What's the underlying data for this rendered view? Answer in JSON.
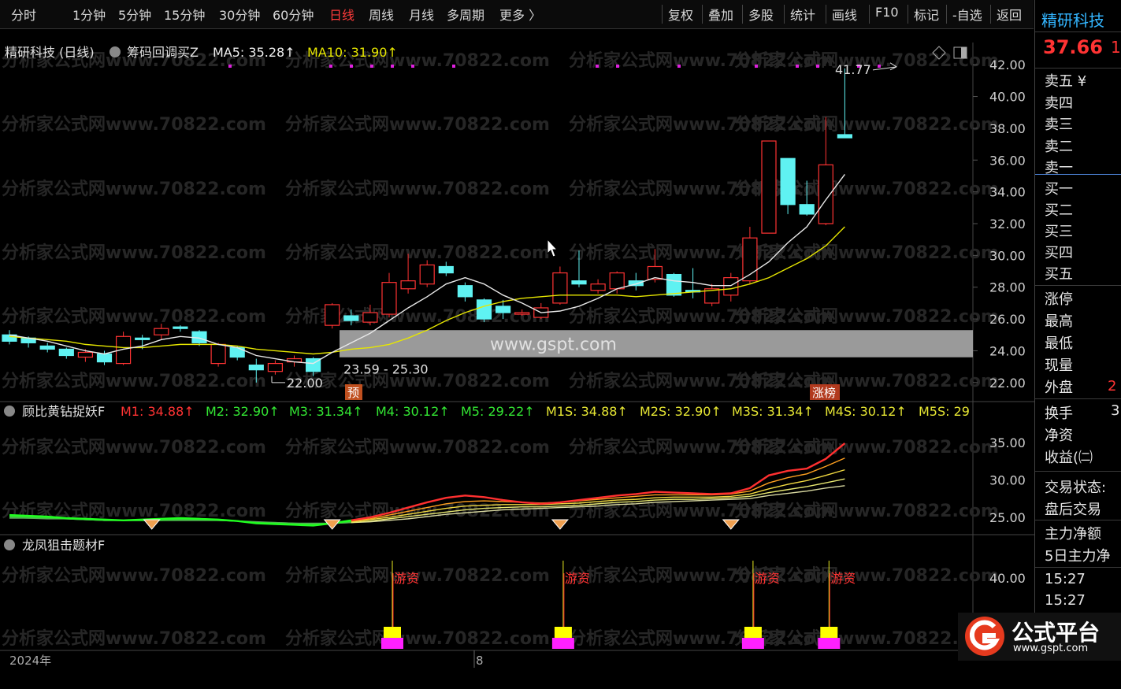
{
  "toolbar": {
    "periods": [
      "分时",
      "1分钟",
      "5分钟",
      "15分钟",
      "30分钟",
      "60分钟",
      "日线",
      "周线",
      "月线",
      "多周期",
      "更多 〉"
    ],
    "active_period": "日线",
    "buttons": [
      "复权",
      "叠加",
      "多股",
      "统计",
      "画线",
      "F10",
      "标记",
      "-自选",
      "返回"
    ]
  },
  "main_chart": {
    "title": "精研科技 (日线)",
    "indicator_name": "筹码回调买Z",
    "ma5_label": "MA5: 35.28↑",
    "ma10_label": "MA10: 31.90↑",
    "high_annotation": "41.77",
    "low_annotation": "22.00",
    "range_annotation": "23.59 - 25.30",
    "signal_yu": "预",
    "signal_zhangbang": "涨榜",
    "watermark_url": "www.gspt.com",
    "watermark_text": "分析家公式网www.70822.com",
    "colors": {
      "up": "#ff3333",
      "down": "#5ff2f2",
      "ma5": "#e8e8e8",
      "ma10": "#e6e600"
    }
  },
  "chart_data": [
    {
      "type": "candlestick",
      "ylim": [
        21,
        43
      ],
      "y_ticks": [
        "42.00",
        "40.00",
        "38.00",
        "36.00",
        "34.00",
        "32.00",
        "30.00",
        "28.00",
        "26.00",
        "24.00",
        "22.00"
      ],
      "candles": [
        {
          "o": 25.0,
          "c": 24.6,
          "h": 25.3,
          "l": 24.4
        },
        {
          "o": 24.8,
          "c": 24.5,
          "h": 24.9,
          "l": 24.2
        },
        {
          "o": 24.3,
          "c": 24.1,
          "h": 24.5,
          "l": 23.9
        },
        {
          "o": 24.1,
          "c": 23.7,
          "h": 24.2,
          "l": 23.5
        },
        {
          "o": 23.6,
          "c": 23.9,
          "h": 24.1,
          "l": 23.3
        },
        {
          "o": 23.8,
          "c": 23.3,
          "h": 24.0,
          "l": 23.1
        },
        {
          "o": 23.2,
          "c": 24.9,
          "h": 25.2,
          "l": 23.1
        },
        {
          "o": 24.8,
          "c": 24.7,
          "h": 25.0,
          "l": 24.1
        },
        {
          "o": 25.0,
          "c": 25.4,
          "h": 25.7,
          "l": 24.7
        },
        {
          "o": 25.5,
          "c": 25.4,
          "h": 25.6,
          "l": 25.2
        },
        {
          "o": 25.2,
          "c": 24.5,
          "h": 25.3,
          "l": 24.3
        },
        {
          "o": 23.2,
          "c": 24.4,
          "h": 24.5,
          "l": 23.0
        },
        {
          "o": 24.2,
          "c": 23.6,
          "h": 24.3,
          "l": 23.4
        },
        {
          "o": 23.1,
          "c": 22.8,
          "h": 23.5,
          "l": 22.0
        },
        {
          "o": 22.7,
          "c": 23.2,
          "h": 23.4,
          "l": 22.5
        },
        {
          "o": 23.3,
          "c": 23.5,
          "h": 23.7,
          "l": 23.0
        },
        {
          "o": 23.5,
          "c": 22.7,
          "h": 23.6,
          "l": 22.4
        },
        {
          "o": 25.6,
          "c": 26.9,
          "h": 27.0,
          "l": 25.4
        },
        {
          "o": 26.2,
          "c": 25.9,
          "h": 26.6,
          "l": 25.6
        },
        {
          "o": 25.8,
          "c": 26.4,
          "h": 26.9,
          "l": 25.6
        },
        {
          "o": 26.3,
          "c": 28.3,
          "h": 28.9,
          "l": 26.1
        },
        {
          "o": 27.9,
          "c": 28.4,
          "h": 30.1,
          "l": 27.6
        },
        {
          "o": 28.2,
          "c": 29.4,
          "h": 29.7,
          "l": 28.0
        },
        {
          "o": 29.3,
          "c": 28.9,
          "h": 29.6,
          "l": 28.7
        },
        {
          "o": 28.1,
          "c": 27.4,
          "h": 28.3,
          "l": 27.1
        },
        {
          "o": 27.2,
          "c": 26.0,
          "h": 27.3,
          "l": 25.8
        },
        {
          "o": 26.8,
          "c": 26.4,
          "h": 27.2,
          "l": 26.0
        },
        {
          "o": 26.3,
          "c": 26.4,
          "h": 26.6,
          "l": 26.2
        },
        {
          "o": 26.1,
          "c": 26.7,
          "h": 27.0,
          "l": 26.0
        },
        {
          "o": 27.0,
          "c": 28.9,
          "h": 29.3,
          "l": 26.9
        },
        {
          "o": 28.4,
          "c": 28.2,
          "h": 30.3,
          "l": 28.0
        },
        {
          "o": 27.8,
          "c": 28.2,
          "h": 28.5,
          "l": 27.6
        },
        {
          "o": 27.9,
          "c": 28.9,
          "h": 29.0,
          "l": 27.6
        },
        {
          "o": 28.4,
          "c": 28.1,
          "h": 28.9,
          "l": 27.8
        },
        {
          "o": 28.5,
          "c": 29.3,
          "h": 30.4,
          "l": 28.3
        },
        {
          "o": 28.8,
          "c": 27.5,
          "h": 28.9,
          "l": 27.4
        },
        {
          "o": 27.8,
          "c": 27.7,
          "h": 29.2,
          "l": 27.3
        },
        {
          "o": 27.0,
          "c": 27.9,
          "h": 28.2,
          "l": 26.8
        },
        {
          "o": 27.5,
          "c": 28.6,
          "h": 28.9,
          "l": 27.1
        },
        {
          "o": 28.4,
          "c": 31.1,
          "h": 31.8,
          "l": 28.2
        },
        {
          "o": 31.4,
          "c": 37.2,
          "h": 37.2,
          "l": 31.4
        },
        {
          "o": 36.1,
          "c": 33.2,
          "h": 36.1,
          "l": 32.6
        },
        {
          "o": 33.2,
          "c": 32.6,
          "h": 34.7,
          "l": 32.5
        },
        {
          "o": 32.0,
          "c": 35.7,
          "h": 38.7,
          "l": 31.9
        },
        {
          "o": 37.6,
          "c": 37.4,
          "h": 41.77,
          "l": 37.4
        }
      ],
      "ma5": [
        25.0,
        24.8,
        24.6,
        24.3,
        24.0,
        23.8,
        24.1,
        24.3,
        24.7,
        24.9,
        24.8,
        24.4,
        24.2,
        23.7,
        23.5,
        23.3,
        23.2,
        23.9,
        24.5,
        25.1,
        25.9,
        26.7,
        27.4,
        28.2,
        28.6,
        28.2,
        27.5,
        27.0,
        26.4,
        26.5,
        26.8,
        27.3,
        27.9,
        28.2,
        28.6,
        28.4,
        28.3,
        28.1,
        28.1,
        28.8,
        29.6,
        30.8,
        31.8,
        33.5,
        35.1
      ],
      "ma10": [
        24.9,
        24.8,
        24.7,
        24.6,
        24.4,
        24.3,
        24.2,
        24.2,
        24.3,
        24.4,
        24.4,
        24.4,
        24.3,
        24.1,
        24.0,
        23.9,
        23.8,
        23.9,
        24.1,
        24.2,
        24.4,
        24.8,
        25.3,
        25.9,
        26.4,
        26.8,
        27.1,
        27.3,
        27.4,
        27.5,
        27.5,
        27.5,
        27.5,
        27.4,
        27.5,
        27.6,
        27.7,
        27.8,
        27.9,
        28.2,
        28.6,
        29.2,
        29.8,
        30.6,
        31.8
      ]
    },
    {
      "type": "line",
      "title": "顾比黄钻捉妖F",
      "ylim": [
        23,
        37.5
      ],
      "y_ticks": [
        "35.00",
        "30.00",
        "25.00"
      ],
      "legend": [
        {
          "label": "M1: 34.88↑",
          "color": "#ff3333"
        },
        {
          "label": "M2: 32.90↑",
          "color": "#33e633"
        },
        {
          "label": "M3: 31.34↑",
          "color": "#33e633"
        },
        {
          "label": "M4: 30.12↑",
          "color": "#33e633"
        },
        {
          "label": "M5: 29.22↑",
          "color": "#33e633"
        },
        {
          "label": "M1S: 34.88↑",
          "color": "#e6e633"
        },
        {
          "label": "M2S: 32.90↑",
          "color": "#e6e633"
        },
        {
          "label": "M3S: 31.34↑",
          "color": "#e6e633"
        },
        {
          "label": "M4S: 30.12↑",
          "color": "#e6e633"
        },
        {
          "label": "M5S: 29",
          "color": "#e6e633"
        }
      ],
      "series": [
        {
          "values": [
            25.3,
            25.2,
            25.1,
            24.9,
            24.8,
            24.7,
            24.6,
            24.7,
            24.8,
            24.9,
            24.8,
            24.7,
            24.5,
            24.2,
            24.1,
            24.0,
            23.9,
            24.2,
            24.6,
            25.0,
            25.6,
            26.3,
            27.0,
            27.6,
            27.9,
            27.7,
            27.3,
            27.0,
            26.8,
            27.0,
            27.3,
            27.6,
            27.9,
            28.1,
            28.4,
            28.3,
            28.2,
            28.1,
            28.2,
            28.9,
            30.6,
            31.2,
            31.5,
            32.8,
            34.88
          ]
        },
        {
          "values": [
            25.2,
            25.1,
            25.0,
            24.9,
            24.8,
            24.7,
            24.6,
            24.6,
            24.7,
            24.8,
            24.8,
            24.7,
            24.5,
            24.3,
            24.2,
            24.1,
            24.0,
            24.2,
            24.5,
            24.8,
            25.3,
            25.8,
            26.3,
            26.8,
            27.1,
            27.2,
            27.1,
            27.0,
            26.9,
            27.0,
            27.2,
            27.4,
            27.6,
            27.8,
            28.0,
            28.0,
            28.0,
            28.0,
            28.1,
            28.5,
            29.6,
            30.3,
            30.8,
            31.8,
            32.9
          ]
        },
        {
          "values": [
            25.1,
            25.0,
            24.9,
            24.8,
            24.7,
            24.6,
            24.6,
            24.6,
            24.6,
            24.7,
            24.7,
            24.6,
            24.5,
            24.3,
            24.2,
            24.1,
            24.1,
            24.2,
            24.4,
            24.7,
            25.0,
            25.4,
            25.8,
            26.2,
            26.5,
            26.6,
            26.7,
            26.7,
            26.7,
            26.8,
            26.9,
            27.1,
            27.3,
            27.4,
            27.6,
            27.7,
            27.7,
            27.7,
            27.8,
            28.1,
            28.8,
            29.4,
            29.9,
            30.6,
            31.34
          ]
        },
        {
          "values": [
            25.0,
            24.9,
            24.9,
            24.8,
            24.7,
            24.6,
            24.6,
            24.6,
            24.6,
            24.6,
            24.6,
            24.6,
            24.5,
            24.3,
            24.3,
            24.2,
            24.1,
            24.2,
            24.3,
            24.5,
            24.8,
            25.1,
            25.4,
            25.7,
            26.0,
            26.2,
            26.3,
            26.4,
            26.4,
            26.5,
            26.6,
            26.8,
            27.0,
            27.1,
            27.3,
            27.4,
            27.4,
            27.5,
            27.6,
            27.8,
            28.3,
            28.7,
            29.1,
            29.6,
            30.12
          ]
        },
        {
          "values": [
            24.9,
            24.9,
            24.8,
            24.8,
            24.7,
            24.6,
            24.6,
            24.6,
            24.6,
            24.6,
            24.6,
            24.6,
            24.5,
            24.4,
            24.3,
            24.2,
            24.2,
            24.2,
            24.3,
            24.4,
            24.6,
            24.8,
            25.1,
            25.4,
            25.6,
            25.8,
            26.0,
            26.1,
            26.2,
            26.3,
            26.4,
            26.5,
            26.7,
            26.8,
            27.0,
            27.1,
            27.2,
            27.3,
            27.4,
            27.5,
            27.9,
            28.2,
            28.5,
            28.9,
            29.22
          ]
        }
      ],
      "diamond_markers_at": [
        7,
        17,
        29,
        38
      ]
    },
    {
      "type": "bar",
      "title": "龙凤狙击题材F",
      "ylim": [
        15,
        50
      ],
      "y_ticks": [
        "40.00",
        "20.00"
      ],
      "signal_label": "游资",
      "signals_at": [
        20,
        29,
        39,
        43
      ]
    }
  ],
  "x_axis": {
    "left_label": "2024年",
    "mid_label": "8"
  },
  "side_panel": {
    "stock_name": "精研科技",
    "price": "37.66",
    "price_suffix": "1",
    "sell_levels": [
      "卖五 ¥",
      "卖四",
      "卖三",
      "卖二",
      "卖一"
    ],
    "buy_levels": [
      "买一",
      "买二",
      "买三",
      "买四",
      "买五"
    ],
    "stats": [
      "涨停",
      "最高",
      "最低",
      "现量",
      "外盘"
    ],
    "stats_suffix": "2",
    "stats2": [
      "换手",
      "净资",
      "收益(㈡"
    ],
    "stats2_suffix": "3",
    "status": [
      "交易状态:",
      "盘后交易"
    ],
    "capital": [
      "主力净额",
      "5日主力净"
    ],
    "times": [
      "15:27",
      "15:27"
    ]
  },
  "logo": {
    "name": "公式平台",
    "url": "www.gspt.com"
  }
}
